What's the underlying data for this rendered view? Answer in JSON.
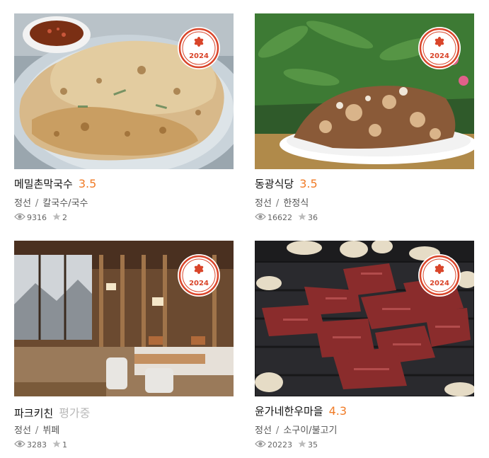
{
  "badge_year": "2024",
  "accent_color": "#f07b26",
  "badge_color": "#d9452a",
  "cards": [
    {
      "name": "메밀촌막국수",
      "score": "3.5",
      "region": "정선",
      "category": "칼국수/국수",
      "views": "9316",
      "stars": "2",
      "image": "buckwheat-pancake-photo"
    },
    {
      "name": "동광식당",
      "score": "3.5",
      "region": "정선",
      "category": "한정식",
      "views": "16622",
      "stars": "36",
      "image": "braised-pork-plate-photo"
    },
    {
      "name": "파크키친",
      "score": "평가중",
      "region": "정선",
      "category": "뷔페",
      "views": "3283",
      "stars": "1",
      "image": "restaurant-interior-photo"
    },
    {
      "name": "윤가네한우마을",
      "score": "4.3",
      "region": "정선",
      "category": "소구이/불고기",
      "views": "20223",
      "stars": "35",
      "image": "grilled-beef-photo"
    }
  ]
}
